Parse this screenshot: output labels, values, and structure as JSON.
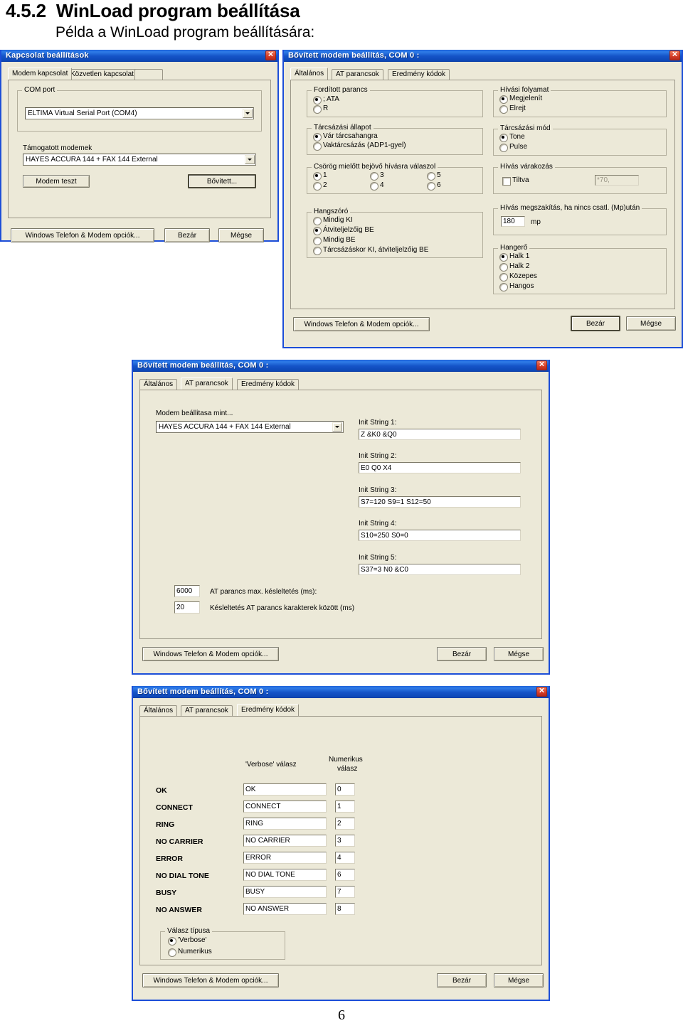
{
  "document": {
    "heading_number": "4.5.2",
    "heading_text": "WinLoad program beállítása",
    "subheading": "Példa a WinLoad program beállítására:",
    "page_number": "6"
  },
  "common": {
    "close_icon": "close-icon",
    "windows_options_button": "Windows Telefon & Modem opciók...",
    "close_button": "Bezár",
    "cancel_button": "Mégse",
    "dropdown_icon": "chevron-down-icon"
  },
  "dialog1": {
    "title": "Kapcsolat beállítások",
    "tabs": [
      {
        "label": "Modem kapcsolat",
        "active": true
      },
      {
        "label": "Közvetlen kapcsolat",
        "active": false
      },
      {
        "label": "",
        "active": false
      }
    ],
    "com_port_group": "COM port",
    "com_port_value": "ELTIMA Virtual Serial Port (COM4)",
    "supported_modems_label": "Támogatott modemek",
    "supported_modems_value": "HAYES ACCURA 144 + FAX 144 External",
    "modem_test_button": "Modem teszt",
    "advanced_button": "Bővített..."
  },
  "dialog2": {
    "title": "Bővített modem beállítás, COM 0 :",
    "tabs": [
      {
        "label": "Általános",
        "active": true
      },
      {
        "label": "AT parancsok",
        "active": false
      },
      {
        "label": "Eredmény kódok",
        "active": false
      }
    ],
    "reverse_command": {
      "group": "Fordított parancs",
      "options": [
        {
          "label": "; ATA",
          "selected": true
        },
        {
          "label": "R",
          "selected": false
        }
      ]
    },
    "dial_state": {
      "group": "Tárcsázási állapot",
      "options": [
        {
          "label": "Vár tárcsahangra",
          "selected": true
        },
        {
          "label": "Vaktárcsázás (ADP1-gyel)",
          "selected": false
        }
      ]
    },
    "rings": {
      "group": "Csörög mielőtt bejövő hívásra válaszol",
      "options": [
        {
          "label": "1",
          "selected": true
        },
        {
          "label": "2",
          "selected": false
        },
        {
          "label": "3",
          "selected": false
        },
        {
          "label": "4",
          "selected": false
        },
        {
          "label": "5",
          "selected": false
        },
        {
          "label": "6",
          "selected": false
        }
      ]
    },
    "speaker": {
      "group": "Hangszóró",
      "options": [
        {
          "label": "Mindig KI",
          "selected": false
        },
        {
          "label": "Átviteljelzőig BE",
          "selected": true
        },
        {
          "label": "Mindig BE",
          "selected": false
        },
        {
          "label": "Tárcsázáskor KI, átviteljelzőig BE",
          "selected": false
        }
      ]
    },
    "call_progress": {
      "group": "Hívási folyamat",
      "options": [
        {
          "label": "Megjelenít",
          "selected": true
        },
        {
          "label": "Elrejt",
          "selected": false
        }
      ]
    },
    "dial_mode": {
      "group": "Tárcsázási mód",
      "options": [
        {
          "label": "Tone",
          "selected": true
        },
        {
          "label": "Pulse",
          "selected": false
        }
      ]
    },
    "call_waiting": {
      "group": "Hívás várakozás",
      "checkbox_label": "Tiltva",
      "checkbox_checked": false,
      "value": "*70,"
    },
    "hangup": {
      "group": "Hívás megszakítás, ha nincs csatl. (Mp)után",
      "value": "180",
      "unit": "mp"
    },
    "volume": {
      "group": "Hangerő",
      "options": [
        {
          "label": "Halk 1",
          "selected": true
        },
        {
          "label": "Halk 2",
          "selected": false
        },
        {
          "label": "Közepes",
          "selected": false
        },
        {
          "label": "Hangos",
          "selected": false
        }
      ]
    }
  },
  "dialog3": {
    "title": "Bővített modem beállítás, COM 0 :",
    "tabs": [
      {
        "label": "Általános",
        "active": false
      },
      {
        "label": "AT parancsok",
        "active": true
      },
      {
        "label": "Eredmény kódok",
        "active": false
      }
    ],
    "modem_as_label": "Modem beállitasa mint...",
    "modem_as_value": "HAYES ACCURA 144 + FAX 144 External",
    "init_strings": [
      {
        "label": "Init String 1:",
        "value": "Z &K0 &Q0"
      },
      {
        "label": "Init String 2:",
        "value": "E0 Q0 X4"
      },
      {
        "label": "Init String 3:",
        "value": "S7=120 S9=1 S12=50"
      },
      {
        "label": "Init String 4:",
        "value": "S10=250 S0=0"
      },
      {
        "label": "Init String 5:",
        "value": "S37=3 N0 &C0"
      }
    ],
    "max_delay_value": "6000",
    "max_delay_label": "AT parancs max. késleltetés (ms):",
    "char_delay_value": "20",
    "char_delay_label": "Késleltetés AT parancs karakterek között (ms)"
  },
  "dialog4": {
    "title": "Bővített modem beállítás, COM 0 :",
    "tabs": [
      {
        "label": "Általános",
        "active": false
      },
      {
        "label": "AT parancsok",
        "active": false
      },
      {
        "label": "Eredmény kódok",
        "active": true
      }
    ],
    "col_verbose": "'Verbose' válasz",
    "col_numeric_line1": "Numerikus",
    "col_numeric_line2": "válasz",
    "rows": [
      {
        "name": "OK",
        "verbose": "OK",
        "numeric": "0"
      },
      {
        "name": "CONNECT",
        "verbose": "CONNECT",
        "numeric": "1"
      },
      {
        "name": "RING",
        "verbose": "RING",
        "numeric": "2"
      },
      {
        "name": "NO CARRIER",
        "verbose": "NO CARRIER",
        "numeric": "3"
      },
      {
        "name": "ERROR",
        "verbose": "ERROR",
        "numeric": "4"
      },
      {
        "name": "NO DIAL TONE",
        "verbose": "NO DIAL TONE",
        "numeric": "6"
      },
      {
        "name": "BUSY",
        "verbose": "BUSY",
        "numeric": "7"
      },
      {
        "name": "NO ANSWER",
        "verbose": "NO ANSWER",
        "numeric": "8"
      }
    ],
    "answer_type": {
      "group": "Válasz típusa",
      "options": [
        {
          "label": "'Verbose'",
          "selected": true
        },
        {
          "label": "Numerikus",
          "selected": false
        }
      ]
    }
  }
}
